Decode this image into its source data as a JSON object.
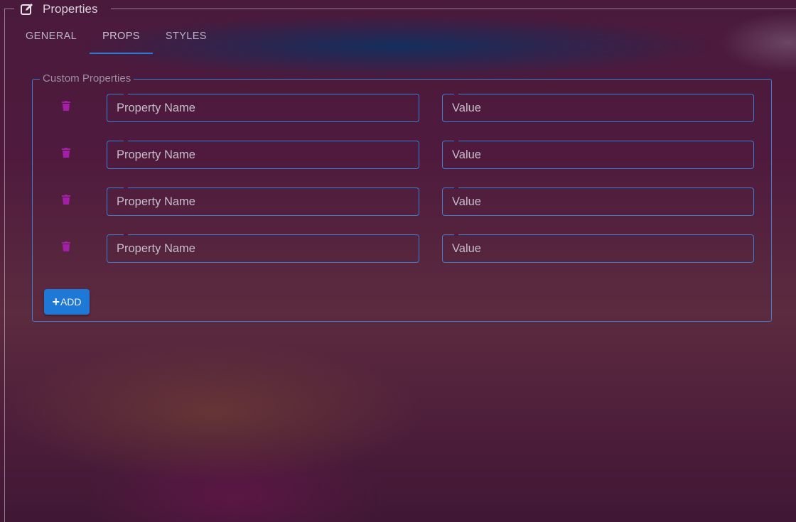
{
  "panel": {
    "title": "Properties",
    "title_icon": "edit-icon"
  },
  "tabs": [
    {
      "label": "GENERAL",
      "active": false
    },
    {
      "label": "PROPS",
      "active": true
    },
    {
      "label": "STYLES",
      "active": false
    }
  ],
  "custom_properties": {
    "legend": "Custom Properties",
    "rows": [
      {
        "name_placeholder": "Property Name",
        "value_placeholder": "Value",
        "delete_icon": "trash-icon"
      },
      {
        "name_placeholder": "Property Name",
        "value_placeholder": "Value",
        "delete_icon": "trash-icon"
      },
      {
        "name_placeholder": "Property Name",
        "value_placeholder": "Value",
        "delete_icon": "trash-icon"
      },
      {
        "name_placeholder": "Property Name",
        "value_placeholder": "Value",
        "delete_icon": "trash-icon"
      }
    ],
    "add_button": {
      "icon": "plus-icon",
      "label": "ADD"
    }
  },
  "colors": {
    "accent": "#1e78d6",
    "border": "#3b7fd0",
    "delete_icon": "#a31fa8",
    "background": "#4f1a3d"
  }
}
